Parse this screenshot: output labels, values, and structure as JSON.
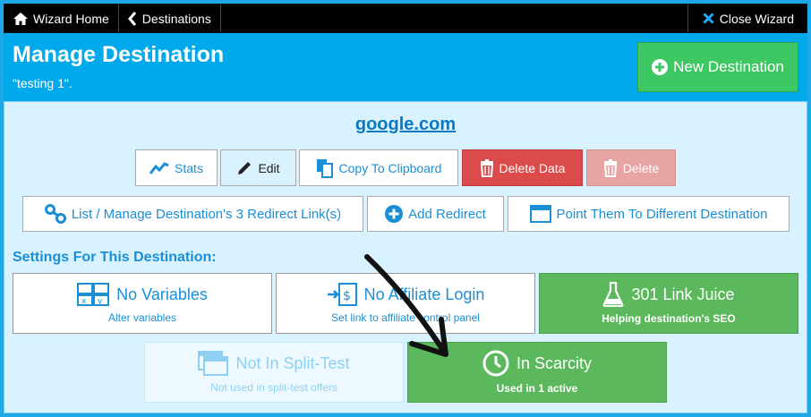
{
  "topbar": {
    "wizard_home": "Wizard Home",
    "destinations": "Destinations",
    "close_wizard": "Close Wizard"
  },
  "header": {
    "title": "Manage Destination",
    "subtitle": "\"testing 1\".",
    "new_destination": "New Destination"
  },
  "destination": {
    "domain": "google.com"
  },
  "actions": {
    "stats": "Stats",
    "edit": "Edit",
    "copy": "Copy To Clipboard",
    "delete_data": "Delete Data",
    "delete": "Delete"
  },
  "links": {
    "list_manage": "List / Manage Destination's 3 Redirect Link(s)",
    "add_redirect": "Add Redirect",
    "point_them": "Point Them To Different Destination"
  },
  "settings": {
    "title": "Settings For This Destination:",
    "variables": {
      "label": "No Variables",
      "sub": "Alter variables"
    },
    "affiliate": {
      "label": "No Affiliate Login",
      "sub": "Set link to affiliate control panel"
    },
    "juice": {
      "label": "301 Link Juice",
      "sub": "Helping destination's SEO"
    },
    "split": {
      "label": "Not In Split-Test",
      "sub": "Not used in split-test offers"
    },
    "scarcity": {
      "label": "In Scarcity",
      "sub": "Used in 1 active"
    }
  },
  "colors": {
    "background": "#1ea8e8",
    "header": "#00a9ec",
    "panel": "#d8f2ff",
    "accent_text": "#1a8fd6",
    "green": "#5cb85c",
    "new_button": "#3ec863",
    "red": "#dc4b4b",
    "pink": "#e8a3a3"
  },
  "icons": [
    "home-icon",
    "chevron-left-icon",
    "close-icon",
    "plus-circle-icon",
    "stats-icon",
    "pencil-icon",
    "clipboard-icon",
    "trash-icon",
    "link-icon",
    "window-icon",
    "variables-icon",
    "dollar-login-icon",
    "flask-icon",
    "split-test-icon",
    "clock-icon",
    "arrow-annotation-icon"
  ]
}
